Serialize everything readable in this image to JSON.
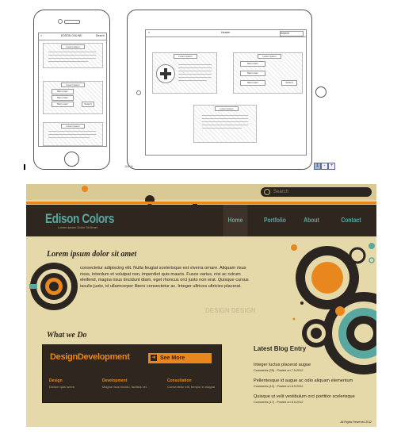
{
  "wireframe": {
    "phone_title": "EDSON ONLINE",
    "phone_search": "Search",
    "phone_box_titles": [
      "Lorem ipsum",
      "Lorem ipsum",
      "Lorem ipsum"
    ],
    "phone_buttons": [
      "Menu item",
      "Menu item",
      "Menu item"
    ],
    "phone_submit": "Submit",
    "tablet_title": "Header",
    "tablet_search": "Search",
    "tablet_box_titles": [
      "Lorem ipsum",
      "Lorem ipsum",
      "Lorem ipsum"
    ],
    "tablet_menu": [
      "Menu item",
      "Menu item",
      "Menu item"
    ],
    "tablet_submit": "Submit",
    "caption": "1NKN",
    "zoom_labels": [
      "1",
      "-",
      "+"
    ]
  },
  "site": {
    "search_placeholder": "Search",
    "logo": "Edison Colors",
    "tagline": "Lorem Ipsum Dolor Sit Amet",
    "nav": [
      "Home",
      "Portfolio",
      "About",
      "Contact"
    ],
    "headline": "Lorem ipsum dolor sit amet",
    "body": "consectetur adipiscing elit. Nulla feugiat scelerisque est viverra ornare. Aliquam risus risus, interdum et volutpat non, imperdiet quis mauris. Fusce varius, nisi ac rutrum eleifend, magna risus tincidunt diam, eget rhoncus orci justo non erat. Quisque cursus iaculis justo, id ullamcorper libero consectetur ac. Integer ultrices ultricies placerat.",
    "what_we_do": "What we Do",
    "dd_design": "Design",
    "dd_development": "Development",
    "see_more": "See More",
    "services": [
      {
        "title": "Design",
        "text": "Dictum quis lorem"
      },
      {
        "title": "Development",
        "text": "Magna risus tincidu, facilisis vel."
      },
      {
        "title": "Consultation",
        "text": "Consectetur elit, tempor in magna"
      }
    ],
    "blog_heading": "Latest Blog Entry",
    "blog": [
      {
        "title": "Integer luctus placerat augue",
        "meta": "Comments (25) - Posted on 7.5.2012"
      },
      {
        "title": "Pellentesque id augue ac odio aliquam elementum",
        "meta": "Comments (12) - Posted on 8.5.2012"
      },
      {
        "title": "Quisque ut velit vestibulum orci porttitor scelerisque",
        "meta": "Comments (17) - Posted on 8.5.2012"
      }
    ],
    "footer": "All Rights Reserved 2012",
    "watermark": "DESIGN DESIGN",
    "colors": {
      "background": "#e6d9a9",
      "header": "#2f2620",
      "accent": "#e8871e",
      "teal": "#5aa7a0"
    }
  }
}
